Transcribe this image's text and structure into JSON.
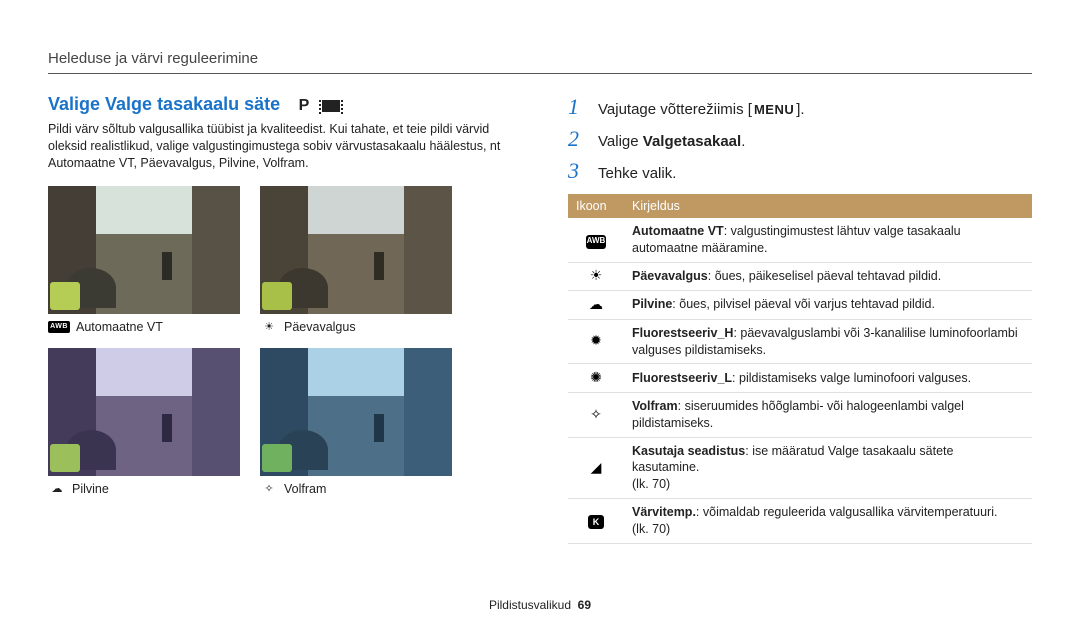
{
  "header": "Heleduse ja värvi reguleerimine",
  "section_title": "Valige Valge tasakaalu säte",
  "mode_p": "P",
  "body_para": "Pildi värv sõltub valgusallika tüübist ja kvaliteedist. Kui tahate, et teie pildi värvid oleksid realistlikud, valige valgustingimustega sobiv värvustasakaalu häälestus, nt Automaatne VT, Päevavalgus, Pilvine, Volfram.",
  "thumbs": {
    "awb": "Automaatne VT",
    "day": "Päevavalgus",
    "cloud": "Pilvine",
    "tung": "Volfram"
  },
  "steps": {
    "s1_pre": "Vajutage võtterežiimis [",
    "s1_menu": "MENU",
    "s1_post": "].",
    "s2_pre": "Valige ",
    "s2_bold": "Valgetasakaal",
    "s2_post": ".",
    "s3": "Tehke valik."
  },
  "table": {
    "col1": "Ikoon",
    "col2": "Kirjeldus",
    "rows": [
      {
        "icon_chip": "AWB",
        "bold": "Automaatne VT",
        "rest": ": valgustingimustest lähtuv valge tasakaalu automaatne määramine."
      },
      {
        "icon": "☀",
        "bold": "Päevavalgus",
        "rest": ": õues, päikeselisel päeval tehtavad pildid."
      },
      {
        "icon": "☁",
        "bold": "Pilvine",
        "rest": ": õues, pilvisel päeval või varjus tehtavad pildid."
      },
      {
        "icon": "✹",
        "bold": "Fluorestseeriv_H",
        "rest": ": päevavalguslambi või 3-kanalilise luminofoorlambi valguses pildistamiseks."
      },
      {
        "icon": "✺",
        "bold": "Fluorestseeriv_L",
        "rest": ": pildistamiseks valge luminofoori valguses."
      },
      {
        "icon": "✧",
        "bold": "Volfram",
        "rest": ": siseruumides hõõglambi- või halogeenlambi valgel pildistamiseks."
      },
      {
        "icon": "◢",
        "bold": "Kasutaja seadistus",
        "rest": ": ise määratud Valge tasakaalu sätete kasutamine.",
        "extra": "(lk. 70)"
      },
      {
        "icon_k": "K",
        "bold": "Värvitemp.",
        "rest": ": võimaldab reguleerida valgusallika värvitemperatuuri.",
        "extra": "(lk. 70)"
      }
    ]
  },
  "footer_label": "Pildistusvalikud",
  "footer_page": "69"
}
